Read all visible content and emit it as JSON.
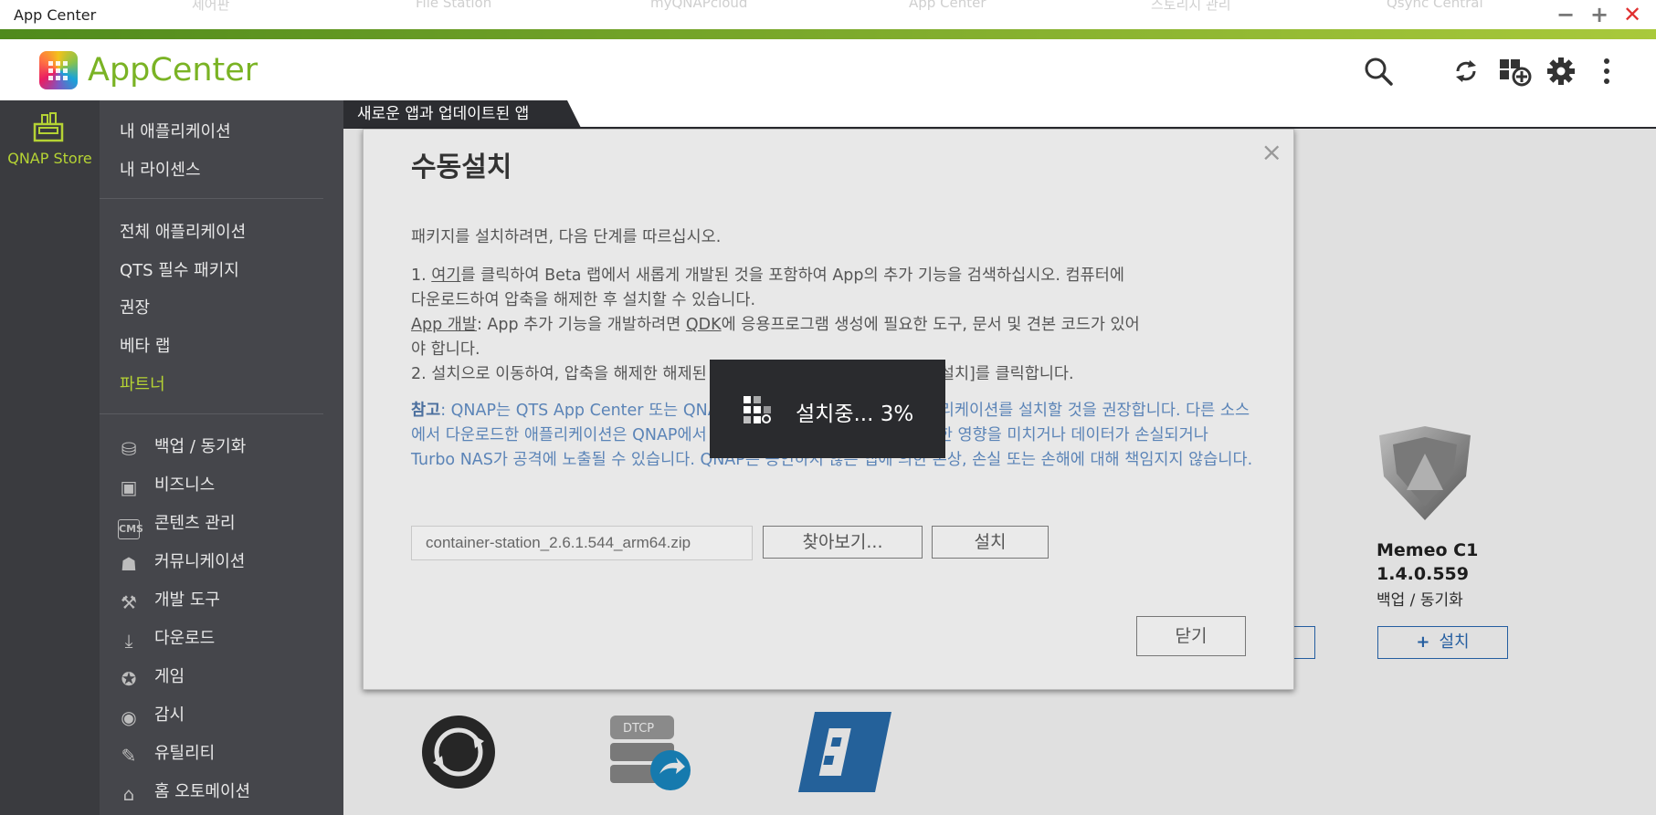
{
  "window": {
    "title": "App Center",
    "ghost_tabs": [
      "제어판",
      "File Station",
      "myQNAPcloud",
      "App Center",
      "스토리지 관리",
      "Qsync Central"
    ],
    "minimize": "−",
    "maximize": "+",
    "close": "✕"
  },
  "header": {
    "brand_part1": "App",
    "brand_part2": "Center",
    "icons": [
      "search-icon",
      "refresh-icon",
      "install-manual-icon",
      "settings-icon",
      "more-icon"
    ]
  },
  "leftnav": {
    "store_label": "QNAP Store"
  },
  "sidebar": {
    "top_items": [
      "내 애플리케이션",
      "내 라이센스"
    ],
    "mid_items": [
      "전체 애플리케이션",
      "QTS 필수 패키지",
      "권장",
      "베타 랩",
      "파트너"
    ],
    "categories": [
      {
        "label": "백업 / 동기화",
        "icon": "backup-icon"
      },
      {
        "label": "비즈니스",
        "icon": "business-icon"
      },
      {
        "label": "콘텐츠 관리",
        "icon": "cms-icon"
      },
      {
        "label": "커뮤니케이션",
        "icon": "communication-icon"
      },
      {
        "label": "개발 도구",
        "icon": "dev-tools-icon"
      },
      {
        "label": "다운로드",
        "icon": "download-icon"
      },
      {
        "label": "게임",
        "icon": "game-icon"
      },
      {
        "label": "감시",
        "icon": "surveillance-icon"
      },
      {
        "label": "유틸리티",
        "icon": "utility-icon"
      },
      {
        "label": "홈 오토메이션",
        "icon": "home-automation-icon"
      }
    ]
  },
  "main": {
    "tab_label": "새로운 앱과 업데이트된 앱",
    "card": {
      "name": "Memeo C1",
      "version": "1.4.0.559",
      "category": "백업 / 동기화",
      "install_label": "설치"
    }
  },
  "dialog": {
    "title": "수동설치",
    "intro": "패키지를 설치하려면, 다음 단계를 따르십시오.",
    "step1_a": "1. ",
    "step1_link": "여기",
    "step1_b": "를 클릭하여 Beta 랩에서 새롭게 개발된 것을 포함하여 App의 추가 기능을 검색하십시오. 컴퓨터에",
    "step1_c": "다운로드하여 압축을 해제한 후 설치할 수 있습니다.",
    "dev_link": "App 개발",
    "dev_a": ": App 추가 기능을 개발하려면 ",
    "dev_qdk": "QDK",
    "dev_b": "에 응용프로그램 생성에 필요한 도구, 문서 및 견본 코드가 있어",
    "dev_c": "야 합니다.",
    "step2": "2. 설치으로 이동하여, 압축을 해제한 해제된 파일이 있는 위치를 탐색한 다음, [설치]를 클릭합니다.",
    "note_label": "참고",
    "note_text": ": QNAP는 QTS App Center 또는 QNAP 웹 사이트에서 다운로드한 애플리케이션를 설치할 것을 권장합니다. 다른 소스에서 다운로드한 애플리케이션은 QNAP에서 승인된 것이 아니며 시스템에 유해한 영향을 미치거나 데이터가 손실되거나 Turbo NAS가 공격에 노출될 수 있습니다. QNAP은 승인하지 않은 앱에 의한 손상, 손실 또는 손해에 대해 책임지지 않습니다.",
    "file_value": "container-station_2.6.1.544_arm64.zip",
    "browse_label": "찾아보기...",
    "install_label": "설치",
    "close_label": "닫기"
  },
  "progress": {
    "text": "설치중... 3%",
    "percent": 3
  }
}
